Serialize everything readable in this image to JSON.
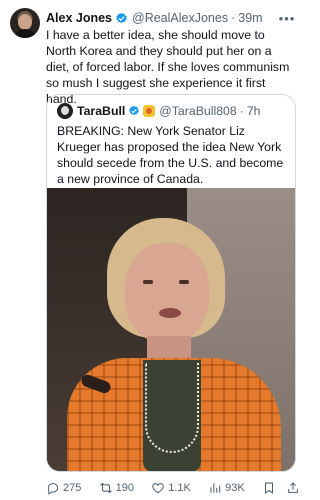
{
  "tweet": {
    "author_name": "Alex Jones",
    "handle": "@RealAlexJones",
    "separator": "·",
    "time": "39m",
    "text": "I have a better idea, she should move to North Korea and they should put her on a diet, of forced labor. If she loves communism so mush I suggest she experience it first hand."
  },
  "quote": {
    "author_name": "TaraBull",
    "handle": "@TaraBull808",
    "separator": "·",
    "time": "7h",
    "text": "BREAKING: New York Senator Liz Krueger has proposed the idea New York should secede from the U.S. and become a new province of Canada."
  },
  "actions": {
    "replies": "275",
    "retweets": "190",
    "likes": "1.1K",
    "views": "93K"
  },
  "colors": {
    "verified": "#1d9bf0",
    "muted_text": "#536471",
    "border": "#cfd9de"
  },
  "icons": [
    "more-icon",
    "verified-icon",
    "reply-icon",
    "retweet-icon",
    "like-icon",
    "views-icon",
    "bookmark-icon",
    "share-icon"
  ]
}
